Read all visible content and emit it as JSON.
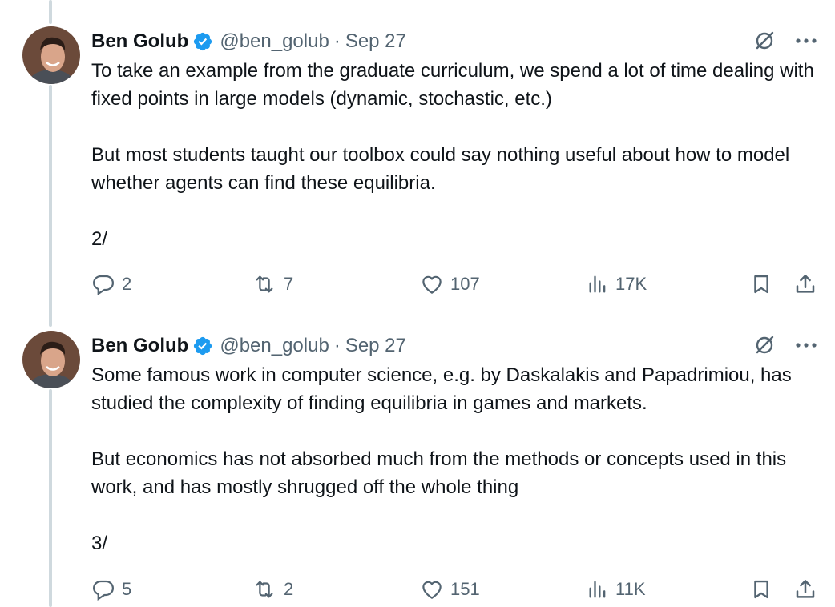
{
  "colors": {
    "text": "#0f1419",
    "secondary": "#536471",
    "verified": "#1d9bf0",
    "thread_line": "#cfd9de"
  },
  "tweets": [
    {
      "author": {
        "name": "Ben Golub",
        "handle": "@ben_golub",
        "verified": true,
        "avatar_icon": "profile-photo"
      },
      "separator": "·",
      "date": "Sep 27",
      "paragraphs": [
        "To take an example from the graduate curriculum, we spend a lot of time dealing with fixed points in large models (dynamic, stochastic, etc.)",
        "But most students taught our toolbox could say nothing useful about how to model whether agents can find these equilibria.",
        "2/"
      ],
      "stats": {
        "replies": "2",
        "reposts": "7",
        "likes": "107",
        "views": "17K"
      }
    },
    {
      "author": {
        "name": "Ben Golub",
        "handle": "@ben_golub",
        "verified": true,
        "avatar_icon": "profile-photo"
      },
      "separator": "·",
      "date": "Sep 27",
      "paragraphs": [
        "Some famous work in computer science, e.g. by Daskalakis and Papadrimiou, has studied the complexity of finding equilibria in games and markets.",
        "But economics has not absorbed much from the methods or concepts used in this work, and has mostly shrugged off the whole thing",
        "3/"
      ],
      "stats": {
        "replies": "5",
        "reposts": "2",
        "likes": "151",
        "views": "11K"
      }
    }
  ],
  "icons": {
    "grok": "grok-icon",
    "more": "more-icon",
    "reply": "reply-icon",
    "repost": "repost-icon",
    "like": "like-icon",
    "views": "views-icon",
    "bookmark": "bookmark-icon",
    "share": "share-icon"
  }
}
